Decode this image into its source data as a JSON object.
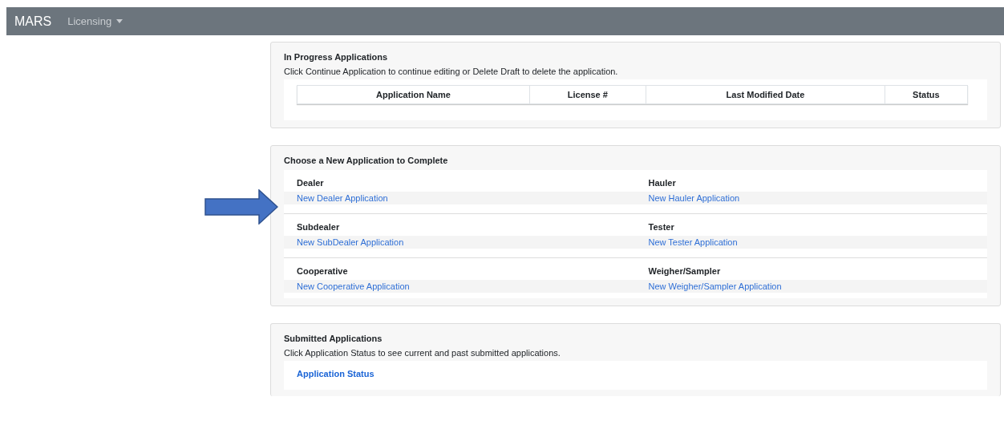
{
  "navbar": {
    "brand": "MARS",
    "menu": {
      "label": "Licensing"
    }
  },
  "in_progress": {
    "title": "In Progress Applications",
    "description": "Click Continue Application to continue editing or Delete Draft to delete the application.",
    "table": {
      "columns": [
        "Application Name",
        "License #",
        "Last Modified Date",
        "Status"
      ]
    }
  },
  "new_application": {
    "title": "Choose a New Application to Complete",
    "rows": [
      {
        "items": [
          {
            "heading": "Dealer",
            "link": "New Dealer Application"
          },
          {
            "heading": "Hauler",
            "link": "New Hauler Application"
          }
        ]
      },
      {
        "items": [
          {
            "heading": "Subdealer",
            "link": "New SubDealer Application"
          },
          {
            "heading": "Tester",
            "link": "New Tester Application"
          }
        ]
      },
      {
        "items": [
          {
            "heading": "Cooperative",
            "link": "New Cooperative Application"
          },
          {
            "heading": "Weigher/Sampler",
            "link": "New Weigher/Sampler Application"
          }
        ]
      }
    ]
  },
  "submitted": {
    "title": "Submitted Applications",
    "description": "Click Application Status to see current and past submitted applications.",
    "link": "Application Status"
  }
}
